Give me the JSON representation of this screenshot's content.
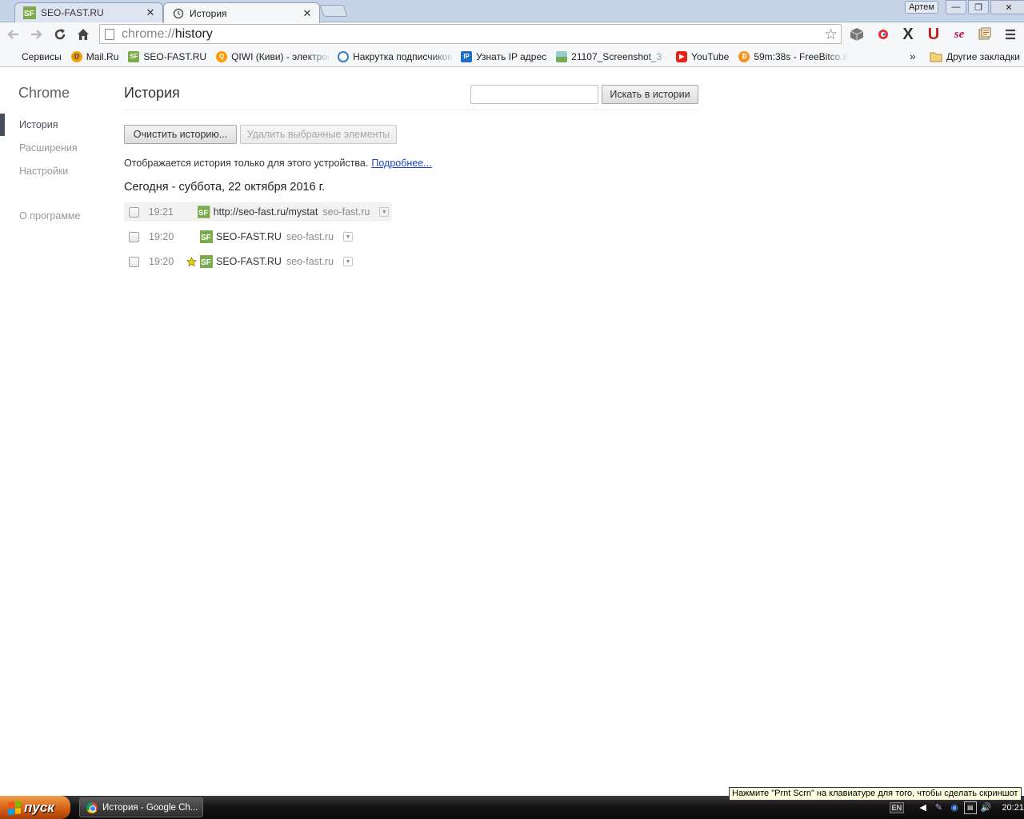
{
  "tabs": [
    {
      "title": "SEO-FAST.RU",
      "active": false
    },
    {
      "title": "История",
      "active": true
    }
  ],
  "window": {
    "user": "Артем",
    "minimize": "—",
    "restore": "❐",
    "close": "✕"
  },
  "omnibox": {
    "scheme": "chrome://",
    "path": "history"
  },
  "bookmarks": [
    {
      "label": "Сервисы",
      "icon": "apps-grid-icon"
    },
    {
      "label": "Mail.Ru",
      "icon": "mailru-icon"
    },
    {
      "label": "SEO-FAST.RU",
      "icon": "seo-fast-icon"
    },
    {
      "label": "QIWI (Киви) - электрон",
      "icon": "qiwi-icon"
    },
    {
      "label": "Накрутка подписчиков",
      "icon": "swirl-icon"
    },
    {
      "label": "Узнать IP адрес",
      "icon": "ip-icon"
    },
    {
      "label": "21107_Screenshot_3 - Э",
      "icon": "image-icon"
    },
    {
      "label": "YouTube",
      "icon": "youtube-icon"
    },
    {
      "label": "59m:38s - FreeBitco.in -",
      "icon": "bitcoin-icon"
    }
  ],
  "bookmarks_more": "»",
  "bookmarks_other": "Другие закладки",
  "sidebar": {
    "brand": "Chrome",
    "items": [
      {
        "label": "История",
        "selected": true
      },
      {
        "label": "Расширения",
        "selected": false
      },
      {
        "label": "Настройки",
        "selected": false
      },
      {
        "label": "О программе",
        "selected": false
      }
    ]
  },
  "page": {
    "title": "История",
    "search_placeholder": "",
    "search_button": "Искать в истории",
    "clear_button": "Очистить историю...",
    "delete_button": "Удалить выбранные элементы",
    "info_text": "Отображается история только для этого устройства.",
    "info_link": "Подробнее...",
    "day_heading": "Сегодня - суббота, 22 октября 2016 г."
  },
  "history": [
    {
      "time": "19:21",
      "title": "http://seo-fast.ru/mystat",
      "domain": "seo-fast.ru",
      "starred": false,
      "hovered": true
    },
    {
      "time": "19:20",
      "title": "SEO-FAST.RU",
      "domain": "seo-fast.ru",
      "starred": false,
      "hovered": false
    },
    {
      "time": "19:20",
      "title": "SEO-FAST.RU",
      "domain": "seo-fast.ru",
      "starred": true,
      "hovered": false
    }
  ],
  "tooltip": "Нажмите \"Prnt Scrn\" на клавиатуре для того, чтобы сделать скриншот",
  "taskbar": {
    "start": "пуск",
    "task": "История - Google Ch...",
    "lang": "EN",
    "clock": "20:21"
  },
  "colors": {
    "seo_fast_green": "#7cab4c",
    "sidebar_marker": "#464e5a",
    "link": "#1a47c4"
  }
}
